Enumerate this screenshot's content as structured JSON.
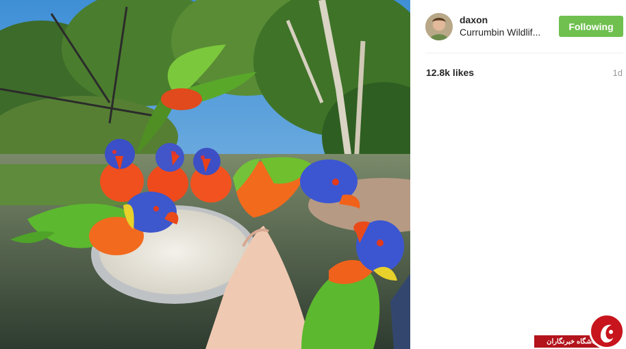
{
  "post": {
    "username": "daxon",
    "location": "Currumbin Wildlif...",
    "follow_label": "Following",
    "likes": "12.8k likes",
    "time_ago": "1d"
  },
  "icons": {
    "avatar": "profile-photo",
    "watermark": "news-agency-logo"
  },
  "watermark": {
    "text": "باشگاه خبرنگاران"
  },
  "colors": {
    "follow_button": "#70c050",
    "watermark_red": "#b3131b",
    "time_text": "#999999"
  }
}
